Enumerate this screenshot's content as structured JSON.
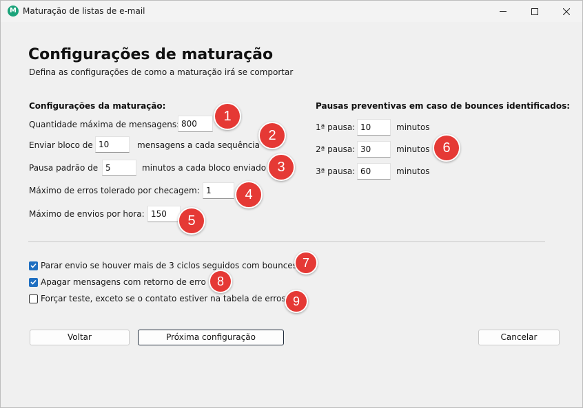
{
  "window": {
    "title": "Maturação de listas de e-mail",
    "icon_letter": "M",
    "icon_color": "#1aa37a"
  },
  "header": {
    "title": "Configurações de maturação",
    "subtitle": "Defina as configurações de como a maturação irá se comportar"
  },
  "maturation": {
    "section_title": "Configurações da maturação:",
    "max_messages": {
      "label": "Quantidade máxima de mensagens:",
      "value": "800"
    },
    "block": {
      "label_before": "Enviar bloco de",
      "value": "10",
      "label_after": "mensagens a cada sequência"
    },
    "pause": {
      "label_before": "Pausa padrão de",
      "value": "5",
      "label_after": "minutos a cada bloco enviado"
    },
    "max_errors": {
      "label": "Máximo de erros tolerado por checagem:",
      "value": "1"
    },
    "max_per_hour": {
      "label": "Máximo de envios por hora:",
      "value": "150"
    }
  },
  "bounces": {
    "section_title": "Pausas preventivas em caso de bounces identificados:",
    "pauses": [
      {
        "label": "1ª pausa:",
        "value": "10",
        "unit": "minutos"
      },
      {
        "label": "2ª pausa:",
        "value": "30",
        "unit": "minutos"
      },
      {
        "label": "3ª pausa:",
        "value": "60",
        "unit": "minutos"
      }
    ]
  },
  "options": [
    {
      "label": "Parar envio se houver mais de 3 ciclos seguidos com bounces",
      "checked": true
    },
    {
      "label": "Apagar mensagens com retorno de erro",
      "checked": true
    },
    {
      "label": "Forçar teste, exceto se o contato estiver na tabela de erros",
      "checked": false
    }
  ],
  "badges": [
    "1",
    "2",
    "3",
    "4",
    "5",
    "6",
    "7",
    "8",
    "9"
  ],
  "badge_color": "#e53935",
  "buttons": {
    "back": "Voltar",
    "next": "Próxima configuração",
    "cancel": "Cancelar"
  }
}
